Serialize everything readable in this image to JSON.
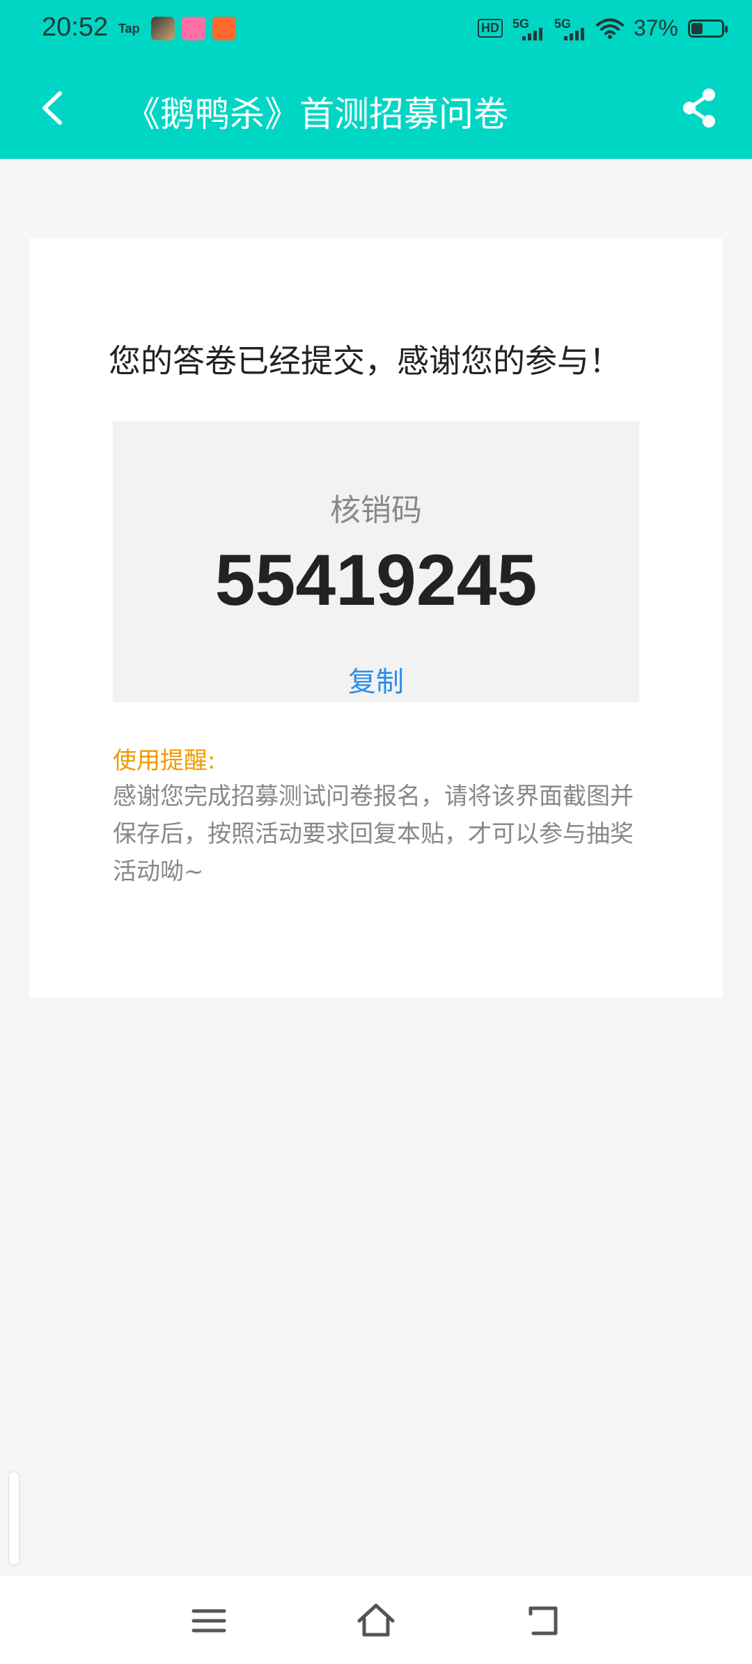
{
  "status_bar": {
    "time": "20:52",
    "notif_tap": "Tap",
    "hd": "HD",
    "net1": "5G",
    "net2": "5G",
    "battery_pct": "37%",
    "battery_level": 0.37
  },
  "app_bar": {
    "title": "《鹅鸭杀》首测招募问卷"
  },
  "result": {
    "thanks": "您的答卷已经提交，感谢您的参与！",
    "code_label": "核销码",
    "code_value": "55419245",
    "copy_label": "复制"
  },
  "reminder": {
    "title": "使用提醒:",
    "body": "感谢您完成招募测试问卷报名，请将该界面截图并保存后，按照活动要求回复本贴，才可以参与抽奖活动呦~"
  },
  "colors": {
    "header": "#00d6c4",
    "copy_link": "#2b8ee8",
    "reminder_title": "#f09a00"
  },
  "icons": {
    "back": "chevron-left-icon",
    "share": "share-icon",
    "nav_menu": "menu-icon",
    "nav_home": "home-icon",
    "nav_back": "back-icon"
  }
}
